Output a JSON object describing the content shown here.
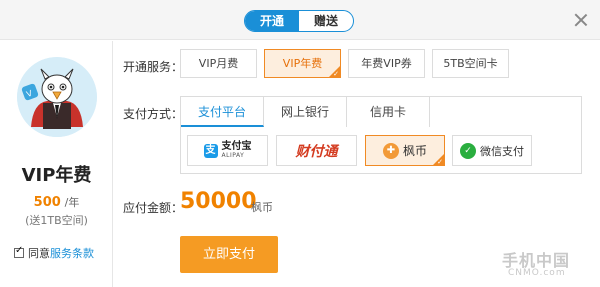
{
  "header": {
    "tabs": [
      {
        "label": "开通",
        "active": true
      },
      {
        "label": "赠送",
        "active": false
      }
    ]
  },
  "plan": {
    "name": "VIP年费",
    "price": "500",
    "price_unit": "/年",
    "bonus": "(送1TB空间)",
    "agree_prefix": "同意",
    "agree_link": "服务条款",
    "agree_checked": true
  },
  "service": {
    "label": "开通服务：",
    "options": [
      {
        "label": "VIP月费",
        "selected": false
      },
      {
        "label": "VIP年费",
        "selected": true
      },
      {
        "label": "年费VIP券",
        "selected": false
      },
      {
        "label": "5TB空间卡",
        "selected": false
      }
    ]
  },
  "payment": {
    "label": "支付方式：",
    "tabs": [
      {
        "label": "支付平台",
        "active": true
      },
      {
        "label": "网上银行",
        "active": false
      },
      {
        "label": "信用卡",
        "active": false
      }
    ],
    "methods": [
      {
        "icon": "alipay-icon",
        "label": "支付宝",
        "sublabel": "ALIPAY",
        "selected": false
      },
      {
        "icon": "tenpay-icon",
        "label": "财付通",
        "selected": false
      },
      {
        "icon": "maple-coin-icon",
        "label": "枫币",
        "selected": true
      },
      {
        "icon": "wechat-pay-icon",
        "label": "微信支付",
        "selected": false
      }
    ]
  },
  "amount": {
    "label": "应付金额：",
    "value": "50000",
    "unit": "枫币"
  },
  "submit": {
    "label": "立即支付"
  },
  "watermark": {
    "cn": "手机中国",
    "en": "CNMO.com"
  },
  "colors": {
    "accent_blue": "#1a8fd7",
    "accent_orange": "#f08200",
    "button_orange": "#f59b23"
  }
}
